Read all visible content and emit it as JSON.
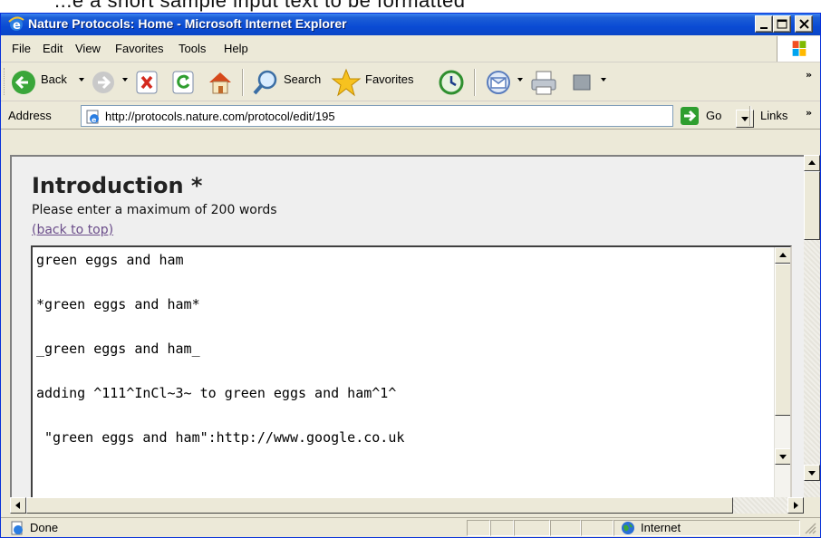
{
  "page_caption_partial": "...e a short sample input text to be formatted",
  "window": {
    "title": "Nature Protocols: Home - Microsoft Internet Explorer",
    "controls": [
      "minimize",
      "maximize",
      "close"
    ]
  },
  "menu": {
    "file": "File",
    "edit": "Edit",
    "view": "View",
    "favorites": "Favorites",
    "tools": "Tools",
    "help": "Help"
  },
  "toolbar": {
    "back_label": "Back",
    "search_label": "Search",
    "favorites_label": "Favorites",
    "icons": [
      "back-icon",
      "forward-icon",
      "stop-icon",
      "refresh-icon",
      "home-icon",
      "search-icon",
      "favorites-icon",
      "history-icon",
      "mail-icon",
      "print-icon",
      "edit-icon"
    ]
  },
  "address": {
    "label": "Address",
    "url": "http://protocols.nature.com/protocol/edit/195",
    "go_label": "Go",
    "links_label": "Links",
    "chevron": "»"
  },
  "content": {
    "heading": "Introduction *",
    "hint": "Please enter a maximum of 200 words",
    "back_to_top": "(back to top)",
    "textarea_lines": [
      "green eggs and ham",
      "*green eggs and ham*",
      "_green eggs and ham_",
      "adding ^111^InCl~3~ to green eggs and ham^1^",
      " \"green eggs and ham\":http://www.google.co.uk"
    ]
  },
  "status": {
    "text": "Done",
    "zone": "Internet"
  },
  "colors": {
    "titlebar": "#0a4bd4",
    "chrome": "#ece9d8",
    "content_bg": "#efefef",
    "visited_link": "#6b4d8a"
  }
}
